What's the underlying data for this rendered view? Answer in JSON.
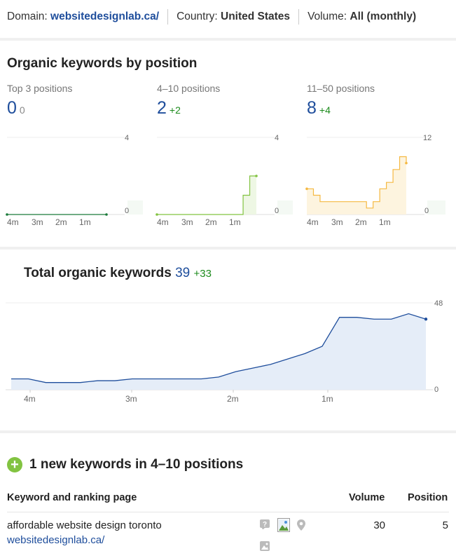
{
  "header": {
    "domain_label": "Domain:",
    "domain_value": "websitedesignlab.ca/",
    "country_label": "Country:",
    "country_value": "United States",
    "volume_label": "Volume:",
    "volume_value": "All (monthly)"
  },
  "positions": {
    "title": "Organic keywords by position",
    "columns": [
      {
        "label": "Top 3 positions",
        "value": "0",
        "delta": "0",
        "color": "#2e7d32"
      },
      {
        "label": "4–10 positions",
        "value": "2",
        "delta": "+2",
        "color": "#82c341"
      },
      {
        "label": "11–50 positions",
        "value": "8",
        "delta": "+4",
        "color": "#f5b942"
      }
    ]
  },
  "total": {
    "title": "Total organic keywords",
    "value": "39",
    "delta": "+33",
    "color": "#1f4e9c"
  },
  "new_keywords": {
    "title": "1 new keywords in 4–10 positions",
    "headers": {
      "keyword": "Keyword and ranking page",
      "volume": "Volume",
      "position": "Position"
    },
    "rows": [
      {
        "keyword": "affordable website design toronto",
        "url": "websitedesignlab.ca/",
        "volume": "30",
        "position": "5"
      }
    ]
  },
  "chart_data": [
    {
      "type": "line",
      "title": "Top 3 positions",
      "x_ticks": [
        "4m",
        "3m",
        "2m",
        "1m"
      ],
      "ylim": [
        0,
        4
      ],
      "y_ticks": [
        "4",
        "0"
      ],
      "values": [
        0,
        0,
        0,
        0,
        0,
        0,
        0,
        0,
        0,
        0
      ]
    },
    {
      "type": "area",
      "title": "4–10 positions",
      "x_ticks": [
        "4m",
        "3m",
        "2m",
        "1m"
      ],
      "ylim": [
        0,
        4
      ],
      "y_ticks": [
        "4",
        "0"
      ],
      "values": [
        0,
        0,
        0,
        0,
        0,
        0,
        0,
        0,
        0,
        0,
        0,
        0,
        0,
        1,
        2,
        2
      ]
    },
    {
      "type": "area",
      "title": "11–50 positions",
      "x_ticks": [
        "4m",
        "3m",
        "2m",
        "1m"
      ],
      "ylim": [
        0,
        12
      ],
      "y_ticks": [
        "12",
        "0"
      ],
      "values": [
        4,
        3,
        2,
        2,
        2,
        2,
        2,
        2,
        2,
        1,
        2,
        4,
        5,
        7,
        9,
        8
      ]
    },
    {
      "type": "area",
      "title": "Total organic keywords",
      "x_ticks": [
        "4m",
        "3m",
        "2m",
        "1m"
      ],
      "ylim": [
        0,
        48
      ],
      "y_ticks": [
        "48",
        "0"
      ],
      "values": [
        6,
        6,
        4,
        4,
        4,
        5,
        5,
        6,
        6,
        6,
        6,
        6,
        7,
        10,
        12,
        14,
        17,
        20,
        24,
        40,
        40,
        39,
        39,
        42,
        39
      ]
    }
  ]
}
